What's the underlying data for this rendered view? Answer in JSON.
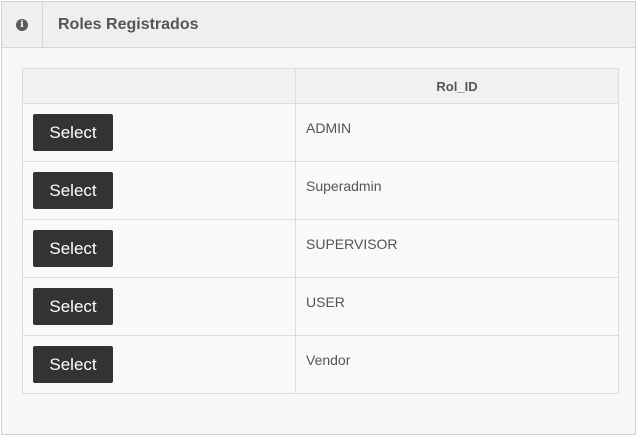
{
  "panel": {
    "title": "Roles Registrados",
    "icon": "info-icon",
    "icon_glyph": "i"
  },
  "table": {
    "columns": [
      "",
      "Rol_ID"
    ],
    "rows": [
      {
        "button_label": "Select",
        "rol_id": "ADMIN"
      },
      {
        "button_label": "Select",
        "rol_id": "Superadmin"
      },
      {
        "button_label": "Select",
        "rol_id": "SUPERVISOR"
      },
      {
        "button_label": "Select",
        "rol_id": "USER"
      },
      {
        "button_label": "Select",
        "rol_id": "Vendor"
      }
    ]
  }
}
